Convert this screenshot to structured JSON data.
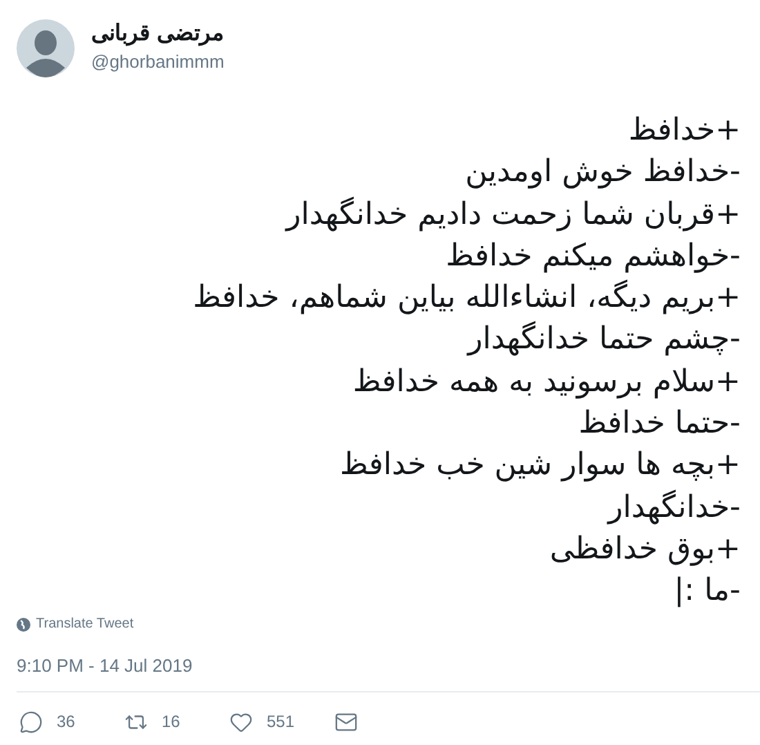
{
  "author": {
    "name": "مرتضی قربانی",
    "handle": "@ghorbanimmm"
  },
  "lines": [
    "+خدافظ",
    "-خدافظ خوش اومدین",
    "+قربان شما زحمت دادیم خدانگهدار",
    "-خواهشم میکنم خدافظ",
    "+بریم دیگه، انشاءالله بیاین شماهم، خدافظ",
    "-چشم حتما خدانگهدار",
    "+سلام برسونید به همه خدافظ",
    "-حتما خدافظ",
    "+بچه ها سوار شین خب خدافظ",
    "-خدانگهدار",
    "+بوق خدافظی",
    "-ما :|"
  ],
  "translate": "Translate Tweet",
  "timestamp": "9:10 PM - 14 Jul 2019",
  "reply": {
    "count": "36"
  },
  "retweet": {
    "count": "16"
  },
  "like": {
    "count": "551"
  }
}
